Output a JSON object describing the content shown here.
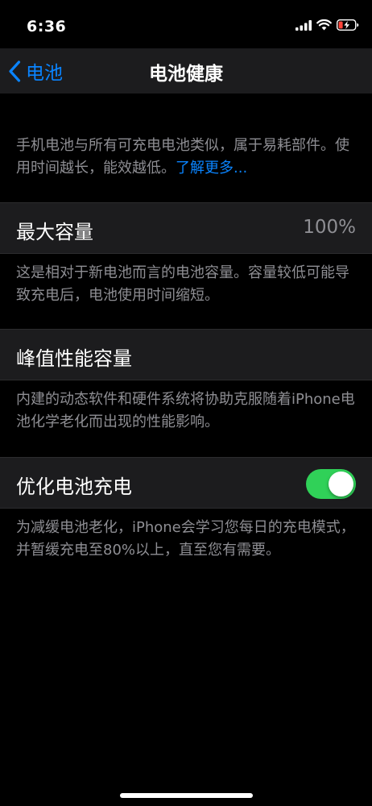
{
  "status_bar": {
    "time": "6:36",
    "icons": [
      "cellular-signal-icon",
      "wifi-icon",
      "battery-charging-icon"
    ]
  },
  "nav": {
    "back_label": "电池",
    "title": "电池健康"
  },
  "intro": {
    "text": "手机电池与所有可充电电池类似，属于易耗部件。使用时间越长，能效越低。",
    "link": "了解更多..."
  },
  "max_capacity": {
    "label": "最大容量",
    "value": "100%",
    "footer": "这是相对于新电池而言的电池容量。容量较低可能导致充电后，电池使用时间缩短。"
  },
  "peak_performance": {
    "label": "峰值性能容量",
    "footer": "内建的动态软件和硬件系统将协助克服随着iPhone电池化学老化而出现的性能影响。"
  },
  "optimized_charging": {
    "label": "优化电池充电",
    "enabled": true,
    "footer": "为减缓电池老化，iPhone会学习您每日的充电模式，并暂缓充电至80%以上，直至您有需要。"
  },
  "colors": {
    "accent": "#0a84ff",
    "toggle_on": "#30d158",
    "cell_bg": "#1c1c1e",
    "secondary_text": "#8e8e93"
  }
}
